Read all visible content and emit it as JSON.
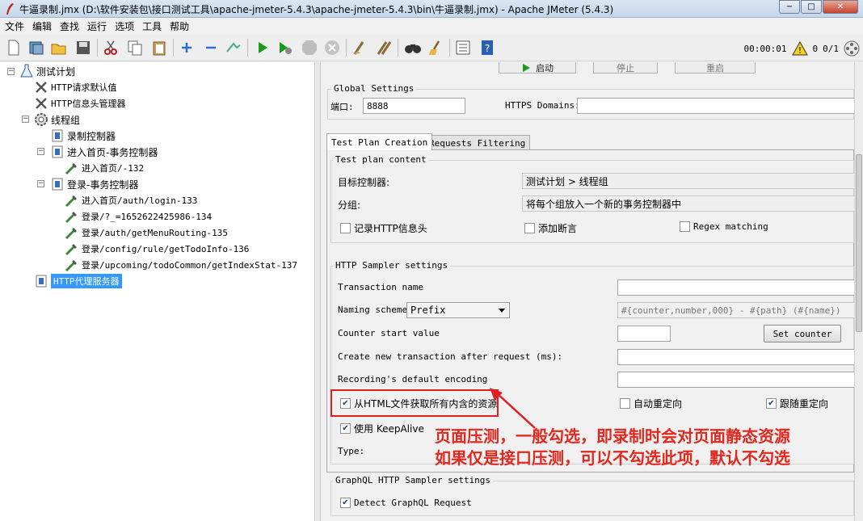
{
  "window": {
    "title": "牛逼录制.jmx (D:\\软件安装包\\接口测试工具\\apache-jmeter-5.4.3\\apache-jmeter-5.4.3\\bin\\牛逼录制.jmx) - Apache JMeter (5.4.3)",
    "min_label": "−",
    "max_label": "□",
    "close_label": "✕"
  },
  "menu": [
    "文件",
    "编辑",
    "查找",
    "运行",
    "选项",
    "工具",
    "帮助"
  ],
  "toolbar": {
    "elapsed": "00:00:01",
    "warn_count": "0",
    "threads": "0/1"
  },
  "tree": {
    "root": "测试计划",
    "http_defaults": "HTTP请求默认值",
    "header_manager": "HTTP信息头管理器",
    "thread_group": "线程组",
    "recorder": "录制控制器",
    "txn_home": "进入首页-事务控制器",
    "home_132": "进入首页/-132",
    "txn_login": "登录-事务控制器",
    "login_133": "进入首页/auth/login-133",
    "login_134": "登录/?_=1652622425986-134",
    "login_135": "登录/auth/getMenuRouting-135",
    "login_136": "登录/config/rule/getTodoInfo-136",
    "login_137": "登录/upcoming/todoCommon/getIndexStat-137",
    "proxy": "HTTP代理服务器"
  },
  "top_buttons": {
    "start": "启动",
    "stop": "停止",
    "restart": "重启"
  },
  "global": {
    "legend": "Global Settings",
    "port_label": "端口:",
    "port_value": "8888",
    "https_label": "HTTPS Domains:",
    "https_value": ""
  },
  "tabs": {
    "creation": "Test Plan Creation",
    "filtering": "Requests Filtering"
  },
  "test_plan_content": {
    "legend": "Test plan content",
    "target_label": "目标控制器:",
    "target_value": "测试计划 > 线程组",
    "group_label": "分组:",
    "group_value": "将每个组放入一个新的事务控制器中",
    "record_headers": "记录HTTP信息头",
    "add_assertions": "添加断言",
    "regex_matching": "Regex matching"
  },
  "sampler": {
    "legend": "HTTP Sampler settings",
    "transaction_name_label": "Transaction name",
    "transaction_name_value": "",
    "naming_scheme_label": "Naming scheme",
    "naming_scheme_value": "Prefix",
    "naming_format_placeholder": "#{counter,number,000} - #{path} (#{name})",
    "counter_start_label": "Counter start value",
    "counter_start_value": "",
    "set_counter": "Set counter",
    "create_new_txn_label": "Create new transaction after request (ms):",
    "create_new_txn_value": "",
    "encoding_label": "Recording's default encoding",
    "encoding_value": "",
    "retrieve_resources": "从HTML文件获取所有内含的资源",
    "auto_redirect": "自动重定向",
    "follow_redirects": "跟随重定向",
    "keepalive": "使用 KeepAlive",
    "type_label": "Type:"
  },
  "graphql": {
    "legend": "GraphQL HTTP Sampler settings",
    "detect": "Detect GraphQL Request"
  },
  "annotation": {
    "line1": "页面压测，一般勾选，即录制时会对页面静态资源",
    "line2": "如果仅是接口压测，可以不勾选此项，默认不勾选",
    "color": "#e0281e"
  },
  "colors": {
    "selection": "#3399ff",
    "play_green": "#1a9a1a"
  }
}
